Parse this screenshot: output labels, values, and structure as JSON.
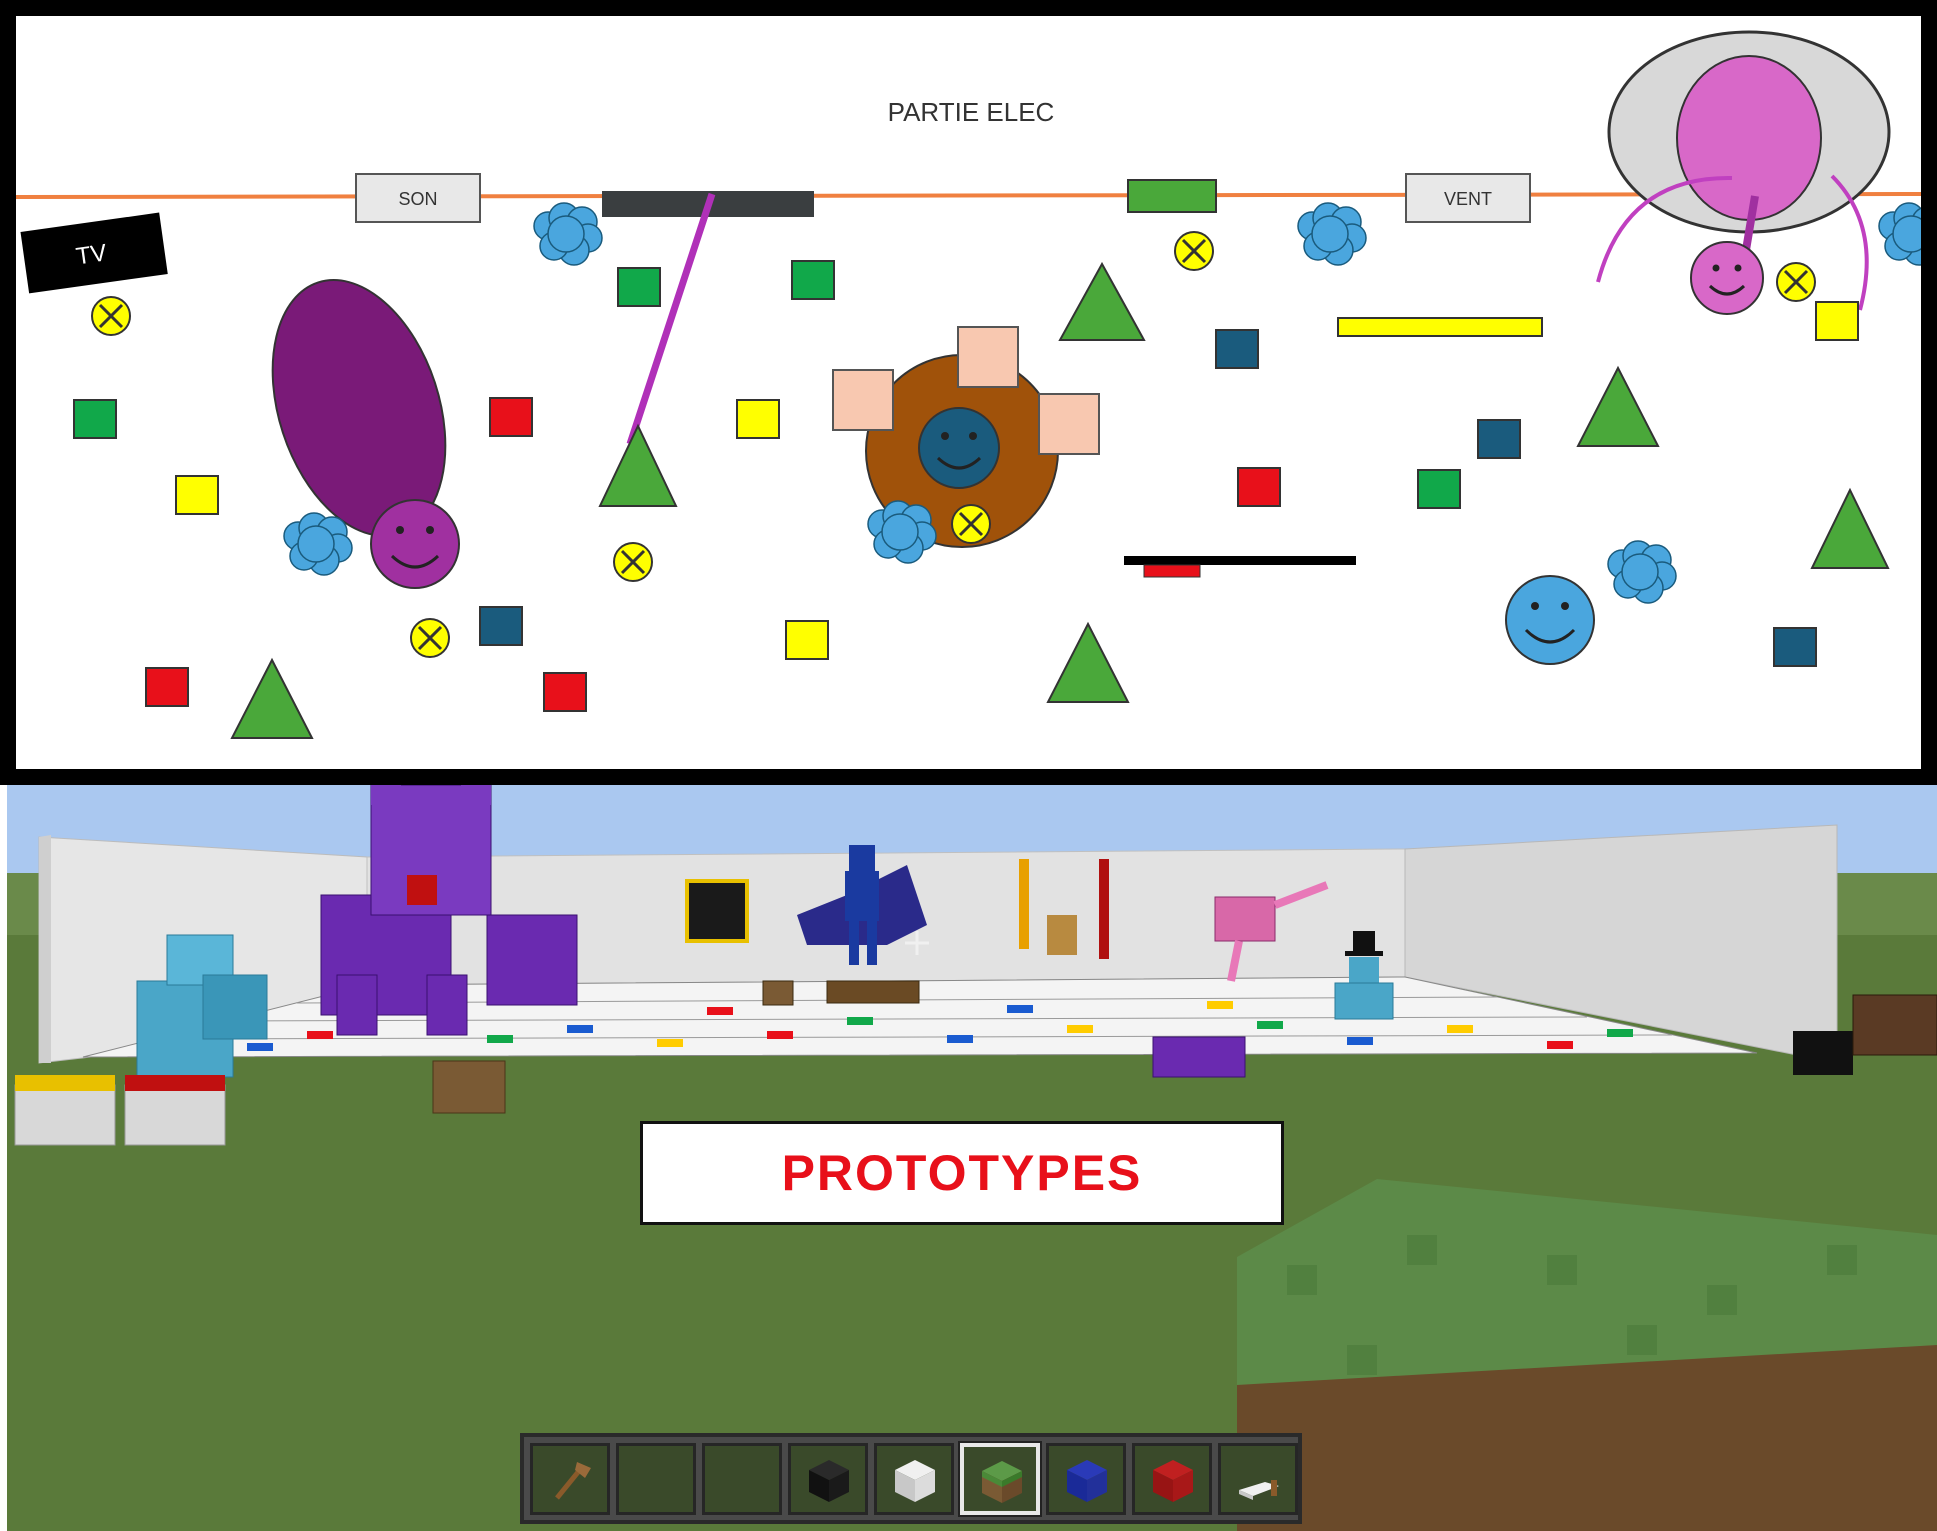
{
  "plan": {
    "title": "PARTIE ELEC",
    "labels": {
      "tv": "TV",
      "sound": "SON",
      "wind": "VENT"
    }
  },
  "scene": {
    "banner": "PROTOTYPES",
    "hotbar": {
      "selected_index": 5,
      "items": [
        "axe-icon",
        "empty",
        "empty",
        "black-block-icon",
        "white-block-icon",
        "grass-block-icon",
        "blue-block-icon",
        "red-block-icon",
        "bed-icon"
      ]
    }
  },
  "colors": {
    "frame": "#000000",
    "cable": "#f08040",
    "green": "#11a84a",
    "red": "#e8101a",
    "yellow": "#ffff00",
    "teal": "#1a5b7d",
    "triangle": "#4aa83a",
    "cloud": "#4aa6de",
    "purple": "#7a1a78",
    "magenta": "#c030c0",
    "pink": "#d868c8",
    "brown": "#a0520a",
    "peach": "#f8c8b0",
    "banner_text": "#e8101a",
    "sky": "#aac8f0",
    "grass": "#5a7a3a"
  }
}
